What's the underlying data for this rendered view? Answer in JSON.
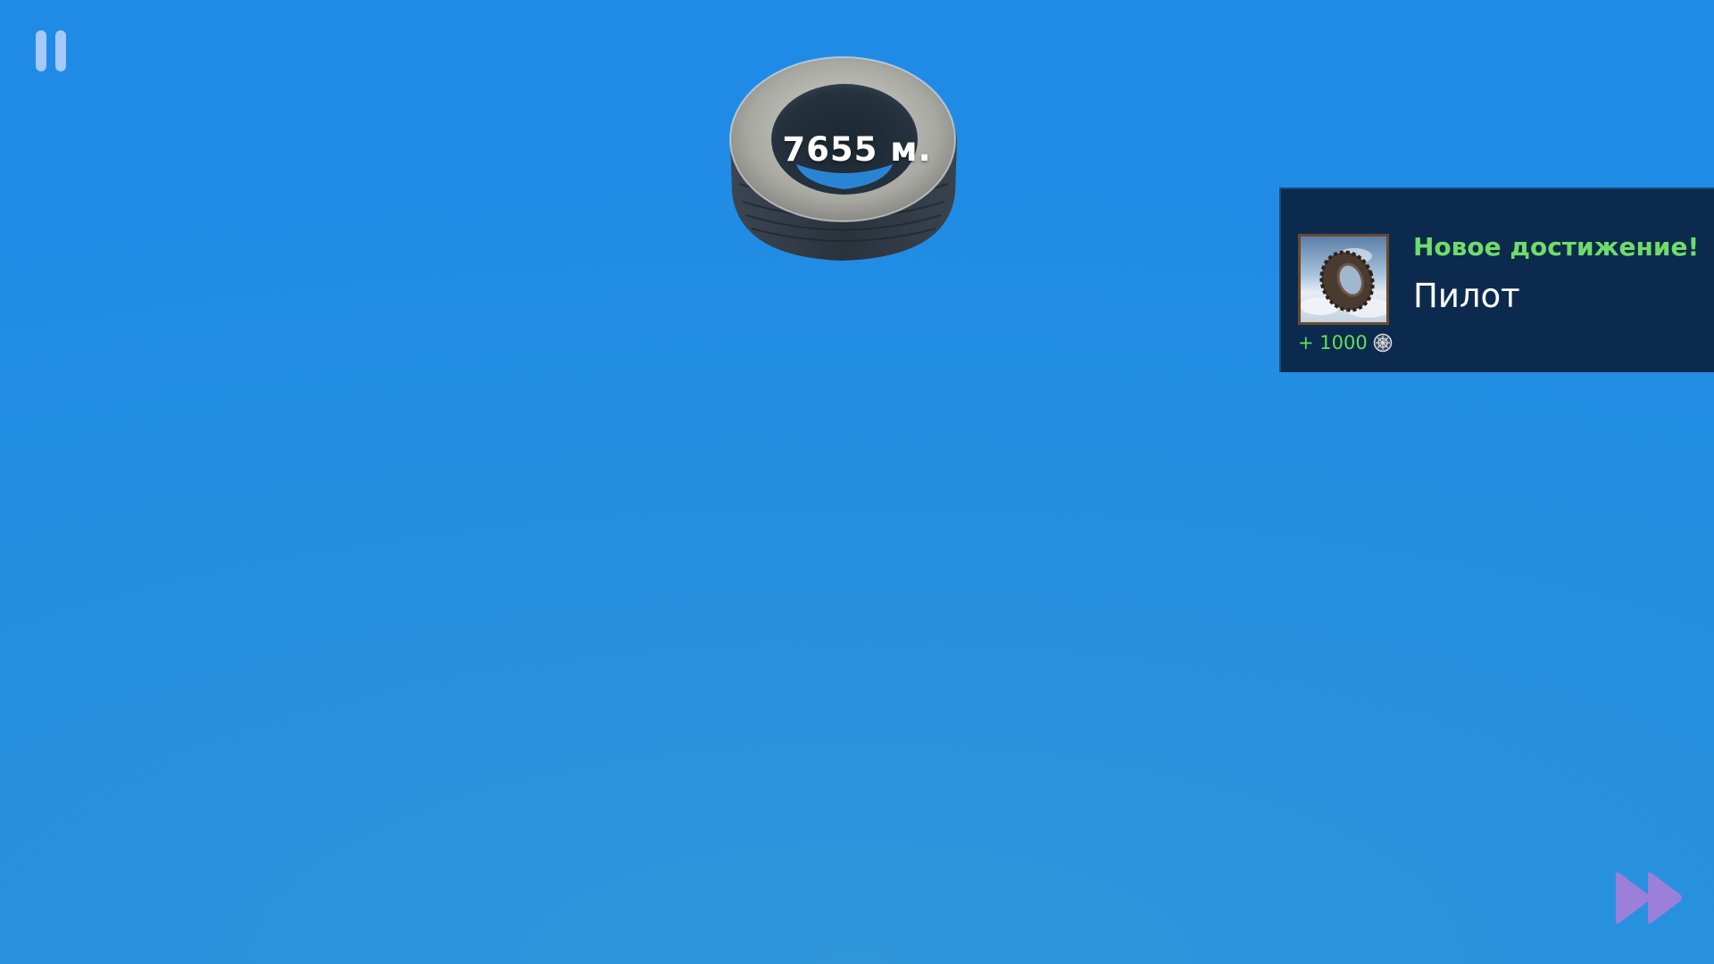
{
  "hud": {
    "distance": "7655 м."
  },
  "achievement": {
    "title": "Новое достижение!",
    "name": "Пилот",
    "reward": "+ 1000"
  },
  "colors": {
    "sky": "#1f8be6",
    "panel": "#0c2a4d",
    "title_green": "#6fdc6a",
    "fast_forward": "#9b7fd9"
  },
  "icons": {
    "pause": "pause-icon",
    "coin": "coin-icon",
    "fast_forward": "fast-forward-icon",
    "tire": "tire-icon"
  }
}
